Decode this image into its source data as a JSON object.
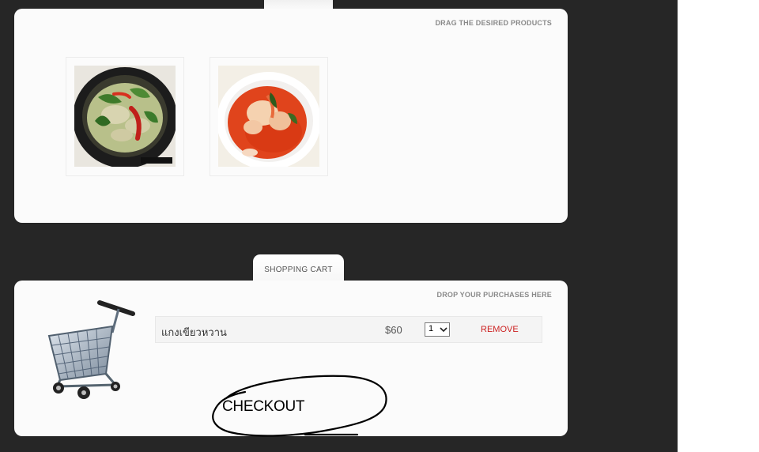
{
  "products_panel": {
    "hint": "DRAG THE DESIRED PRODUCTS",
    "items": [
      {
        "name": "green-curry"
      },
      {
        "name": "tom-yum"
      }
    ]
  },
  "cart": {
    "tab_label": "SHOPPING CART",
    "hint": "DROP YOUR PURCHASES HERE",
    "rows": [
      {
        "name": "แกงเขียวหวาน",
        "price": "$60",
        "qty": "1",
        "remove": "REMOVE"
      }
    ]
  },
  "checkout": {
    "label": "CHECKOUT"
  },
  "colors": {
    "page_bg": "#262626",
    "panel": "#fbfbfb",
    "remove_link": "#cc1f1f"
  }
}
